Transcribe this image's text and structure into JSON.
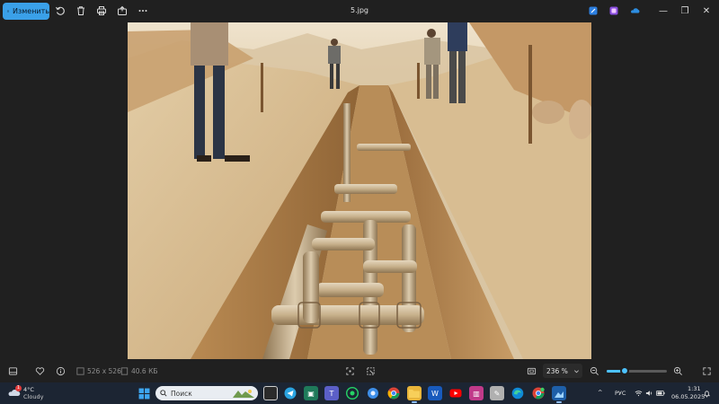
{
  "toolbar": {
    "edit_label": "Изменить",
    "file_title": "5.jpg",
    "icons": [
      "edit-icon",
      "rotate-icon",
      "delete-icon",
      "print-icon",
      "share-icon",
      "more-icon"
    ],
    "right_icons": [
      "clipchamp-icon",
      "designer-icon",
      "onedrive-icon"
    ]
  },
  "window": {
    "minimize": "—",
    "maximize": "❐",
    "close": "✕"
  },
  "status": {
    "dimensions": "526 x 526",
    "file_size": "40.6 КБ",
    "zoom_value": "236 %",
    "zoom_fraction": 0.3
  },
  "taskbar": {
    "weather_temp": "4°C",
    "weather_cond": "Cloudy",
    "weather_badge": "1",
    "search_placeholder": "Поиск",
    "language": "РУС",
    "time": "1:31",
    "date": "06.05.2025"
  },
  "colors": {
    "accent": "#3aa0e8",
    "slider": "#4cc2ff",
    "taskbar": "#1c2533"
  }
}
